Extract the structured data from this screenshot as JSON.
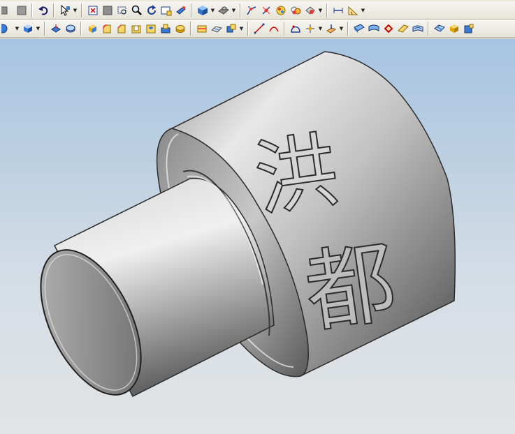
{
  "toolbar_row1": {
    "buttons": [
      {
        "name": "partial-gray-icon"
      },
      {
        "name": "gray-box-icon"
      },
      {
        "name": "undo-icon"
      },
      {
        "name": "select-filter-icon",
        "dropdown": true
      },
      {
        "name": "fit-view-icon"
      },
      {
        "name": "shaded-square-icon"
      },
      {
        "name": "zoom-area-icon"
      },
      {
        "name": "zoom-icon"
      },
      {
        "name": "rotate-icon"
      },
      {
        "name": "view-window-icon"
      },
      {
        "name": "section-view-icon"
      },
      {
        "name": "shaded-cube-icon",
        "dropdown": true
      },
      {
        "name": "render-style-icon",
        "dropdown": true
      },
      {
        "name": "sketch-snap-icon"
      },
      {
        "name": "constraint-icon"
      },
      {
        "name": "analysis-icon"
      },
      {
        "name": "edit-color-icon"
      },
      {
        "name": "material-icon",
        "dropdown": true
      },
      {
        "name": "measure-distance-icon"
      },
      {
        "name": "measure-angle-icon",
        "dropdown": true
      }
    ]
  },
  "toolbar_row2": {
    "buttons": [
      {
        "name": "circle-partial-icon",
        "dropdown": true
      },
      {
        "name": "cube-view-icon",
        "dropdown": true
      },
      {
        "name": "extrude-icon"
      },
      {
        "name": "revolve-icon"
      },
      {
        "name": "solid-block-icon"
      },
      {
        "name": "edge-blend-icon"
      },
      {
        "name": "chamfer-icon"
      },
      {
        "name": "shell-icon"
      },
      {
        "name": "hole-icon"
      },
      {
        "name": "boss-icon"
      },
      {
        "name": "pad-icon"
      },
      {
        "name": "trim-body-icon"
      },
      {
        "name": "sew-icon"
      },
      {
        "name": "unite-icon",
        "dropdown": true
      },
      {
        "name": "line-icon"
      },
      {
        "name": "arc-icon"
      },
      {
        "name": "spline-icon"
      },
      {
        "name": "point-icon",
        "dropdown": true
      },
      {
        "name": "datum-plane-icon",
        "dropdown": true
      },
      {
        "name": "sheet-icon"
      },
      {
        "name": "surface-blue-icon"
      },
      {
        "name": "curve-red-icon"
      },
      {
        "name": "surface-yellow-icon"
      },
      {
        "name": "offset-surface-icon"
      },
      {
        "name": "mesh-icon"
      },
      {
        "name": "gold-block-icon"
      },
      {
        "name": "blue-block-icon"
      }
    ]
  },
  "model": {
    "engraved_text": [
      "洪",
      "都"
    ],
    "colors": {
      "background_top": "#a7c4e2",
      "background_bottom": "#e2e4e5",
      "part_light": "#e6e6e6",
      "part_mid": "#a5a5a5",
      "part_dark": "#4d4d4d",
      "edge": "#2a2a2a"
    }
  }
}
